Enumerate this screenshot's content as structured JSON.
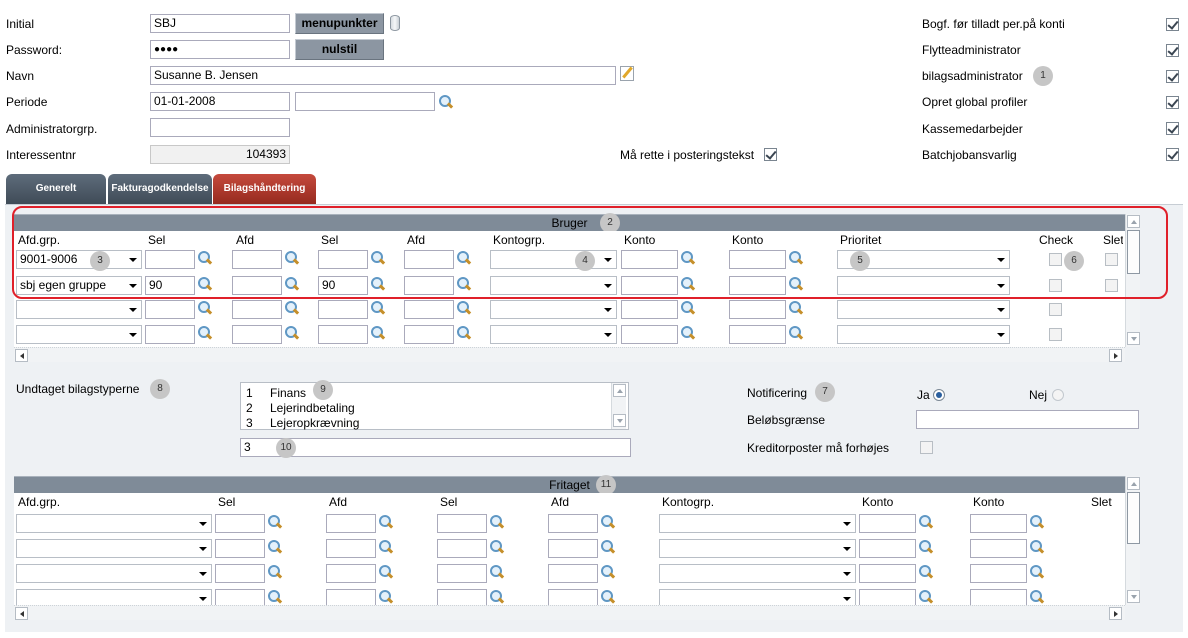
{
  "form": {
    "initial_label": "Initial",
    "initial_value": "SBJ",
    "menupunkter_btn": "menupunkter",
    "password_label": "Password:",
    "password_value": "●●●●",
    "nulstil_btn": "nulstil",
    "navn_label": "Navn",
    "navn_value": "Susanne B. Jensen",
    "periode_label": "Periode",
    "periode_from": "01-01-2008",
    "periode_to": "",
    "admgrp_label": "Administratorgrp.",
    "admgrp_value": "",
    "interessentnr_label": "Interessentnr",
    "interessentnr_value": "104393",
    "maa_rette_label": "Må rette i posteringstekst"
  },
  "rights": [
    {
      "label": "Bogf. før tilladt per.på konti",
      "checked": true
    },
    {
      "label": "Flytteadministrator",
      "checked": true
    },
    {
      "label": "bilagsadministrator",
      "checked": true
    },
    {
      "label": "Opret global profiler",
      "checked": true
    },
    {
      "label": "Kassemedarbejder",
      "checked": true
    },
    {
      "label": "Batchjobansvarlig",
      "checked": true
    }
  ],
  "tabs": [
    "Generelt",
    "Fakturagodkendelse",
    "Bilagshåndtering"
  ],
  "bruger": {
    "title": "Bruger",
    "headers": [
      "Afd.grp.",
      "Sel",
      "Afd",
      "Sel",
      "Afd",
      "Kontogrp.",
      "Konto",
      "Konto",
      "Prioritet",
      "Check",
      "Slet"
    ],
    "rows": [
      {
        "afdgrp": "9001-9006",
        "sel1": "",
        "sel2": ""
      },
      {
        "afdgrp": "sbj egen gruppe",
        "sel1": "90",
        "sel2": "90"
      },
      {
        "afdgrp": "",
        "sel1": "",
        "sel2": ""
      },
      {
        "afdgrp": "",
        "sel1": "",
        "sel2": ""
      }
    ]
  },
  "undtaget": {
    "label": "Undtaget bilagstyperne",
    "items": [
      {
        "num": "1",
        "name": "Finans"
      },
      {
        "num": "2",
        "name": "Lejerindbetaling"
      },
      {
        "num": "3",
        "name": "Lejeropkrævning"
      }
    ],
    "input_value": "3"
  },
  "notif": {
    "label": "Notificering",
    "ja": "Ja",
    "nej": "Nej",
    "beloeb_label": "Beløbsgrænse",
    "kreditor_label": "Kreditorposter må forhøjes"
  },
  "fritaget": {
    "title": "Fritaget",
    "headers": [
      "Afd.grp.",
      "Sel",
      "Afd",
      "Sel",
      "Afd",
      "Kontogrp.",
      "Konto",
      "Konto",
      "Slet"
    ]
  },
  "badges": [
    "1",
    "2",
    "3",
    "4",
    "5",
    "6",
    "7",
    "8",
    "9",
    "10",
    "11"
  ]
}
